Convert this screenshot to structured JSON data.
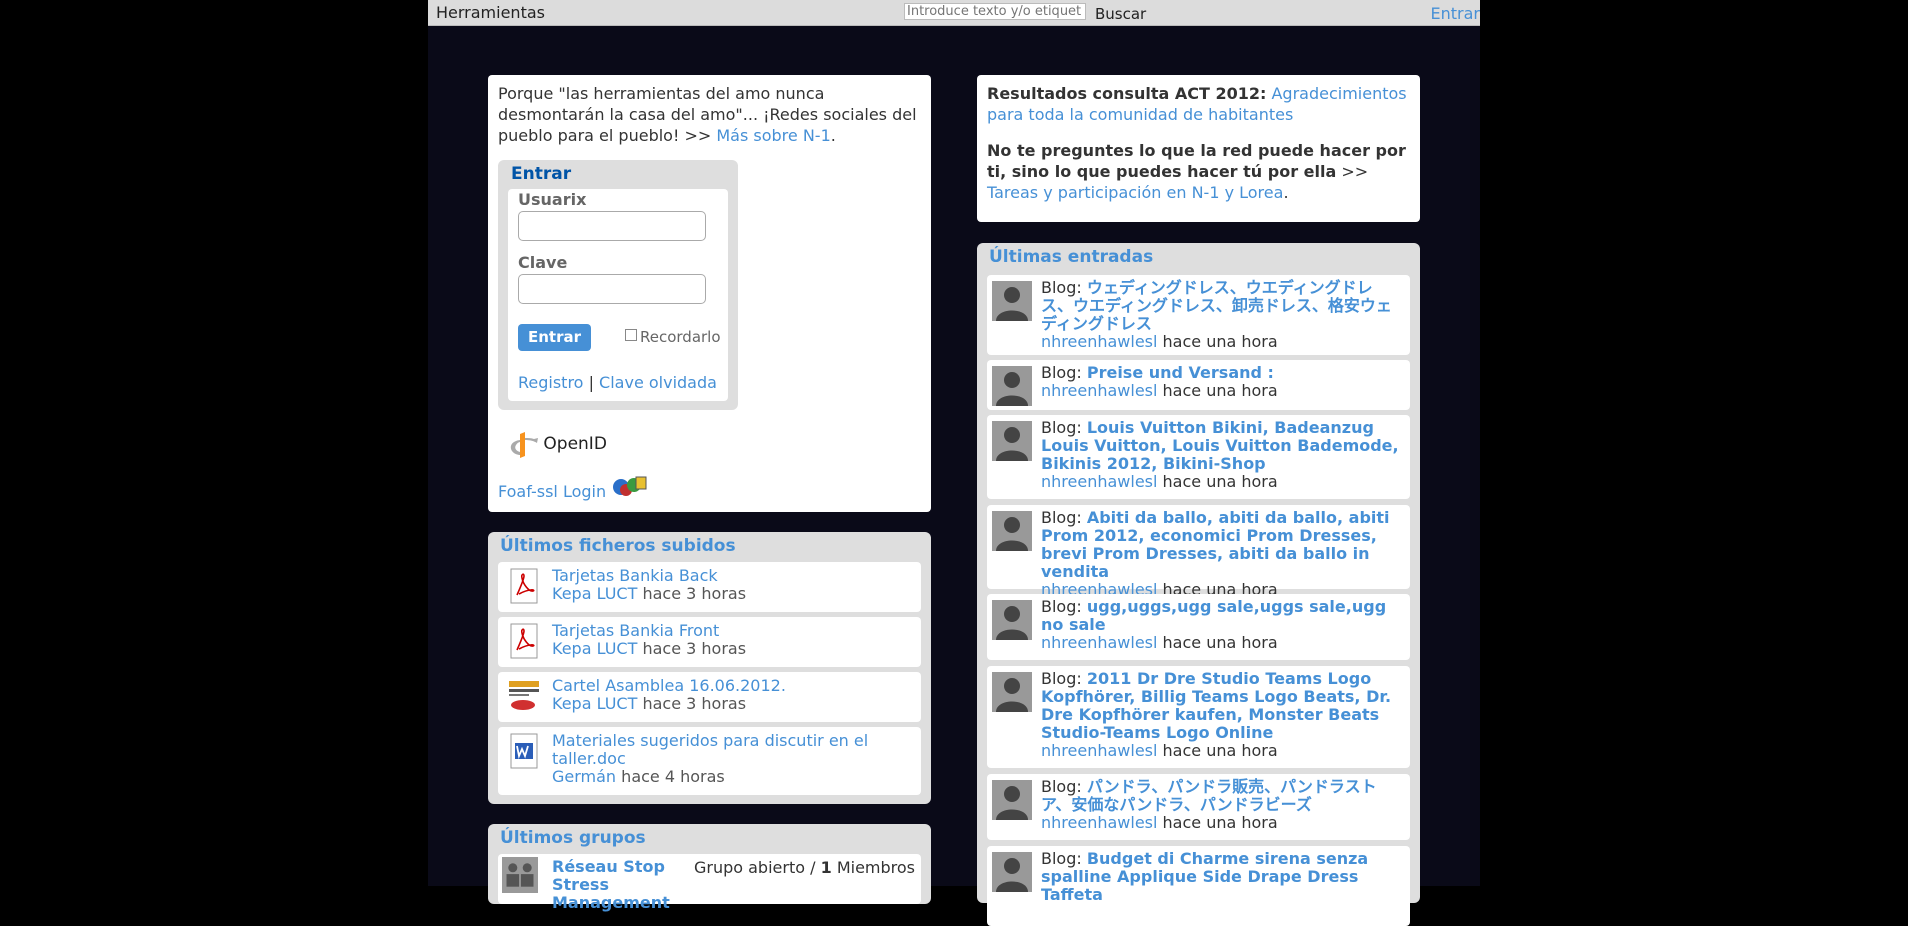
{
  "topbar": {
    "tools": "Herramientas",
    "search_placeholder": "Introduce texto y/o etiquet",
    "search_button": "Buscar",
    "login": "Entrar"
  },
  "intro": {
    "text": "Porque \"las herramientas del amo nunca desmontarán la casa del amo\"... ¡Redes sociales del pueblo para el pueblo! >> ",
    "link": "Más sobre N-1",
    "end": "."
  },
  "login": {
    "title": "Entrar",
    "user_label": "Usuarix",
    "pass_label": "Clave",
    "submit": "Entrar",
    "remember": "Recordarlo",
    "register": "Registro",
    "separator": "|",
    "forgot": "Clave olvidada",
    "openid": "OpenID",
    "foaf": "Foaf-ssl Login"
  },
  "files": {
    "title": "Últimos ficheros subidos",
    "items": [
      {
        "name": "Tarjetas Bankia Back",
        "user": "Kepa LUCT",
        "time": "hace 3 horas",
        "icon": "pdf-icon"
      },
      {
        "name": "Tarjetas Bankia Front",
        "user": "Kepa LUCT",
        "time": "hace 3 horas",
        "icon": "pdf-icon"
      },
      {
        "name": "Cartel Asamblea 16.06.2012.",
        "user": "Kepa LUCT",
        "time": "hace 3 horas",
        "icon": "image-thumbnail"
      },
      {
        "name": "Materiales sugeridos para discutir en el taller.doc",
        "user": "Germán",
        "time": "hace 4 horas",
        "icon": "word-icon"
      }
    ]
  },
  "groups": {
    "title": "Últimos grupos",
    "items": [
      {
        "name": "Réseau Stop Stress Management",
        "status": "Grupo abierto / ",
        "count": "1",
        "members": "Miembros"
      }
    ]
  },
  "results": {
    "bold": "Resultados consulta ACT 2012:",
    "link": "Agradecimientos para toda la comunidad de habitantes",
    "bold2": "No te preguntes lo que la red puede hacer por ti, sino lo que puedes hacer tú por ella",
    "arrow": " >> ",
    "link2": "Tareas y participación en N-1 y Lorea",
    "end": "."
  },
  "entries": {
    "title": "Últimas entradas",
    "prefix": "Blog: ",
    "items": [
      {
        "title": "ウェディングドレス、ウエディングドレス、ウエディングドレス、卸売ドレス、格安ウェディングドレス",
        "user": "nhreenhawlesl",
        "time": "hace una hora"
      },
      {
        "title": "Preise und Versand :",
        "user": "nhreenhawlesl",
        "time": "hace una hora"
      },
      {
        "title": "Louis Vuitton Bikini, Badeanzug Louis Vuitton, Louis Vuitton Bademode, Bikinis 2012, Bikini-Shop",
        "user": "nhreenhawlesl",
        "time": "hace una hora"
      },
      {
        "title": "Abiti da ballo, abiti da ballo, abiti Prom 2012, economici Prom Dresses, brevi Prom Dresses, abiti da ballo in vendita",
        "user": "nhreenhawlesl",
        "time": "hace una hora"
      },
      {
        "title": "ugg,uggs,ugg sale,uggs sale,ugg no sale",
        "user": "nhreenhawlesl",
        "time": "hace una hora"
      },
      {
        "title": "2011 Dr Dre Studio Teams Logo Kopfhörer, Billig Teams Logo Beats, Dr. Dre Kopfhörer kaufen, Monster Beats Studio-Teams Logo Online",
        "user": "nhreenhawlesl",
        "time": "hace una hora"
      },
      {
        "title": "パンドラ、パンドラ販売、パンドラストア、安価なパンドラ、パンドラビーズ",
        "user": "nhreenhawlesl",
        "time": "hace una hora"
      },
      {
        "title": "Budget di Charme sirena senza spalline Applique Side Drape Dress Taffeta",
        "user": "",
        "time": ""
      }
    ]
  }
}
